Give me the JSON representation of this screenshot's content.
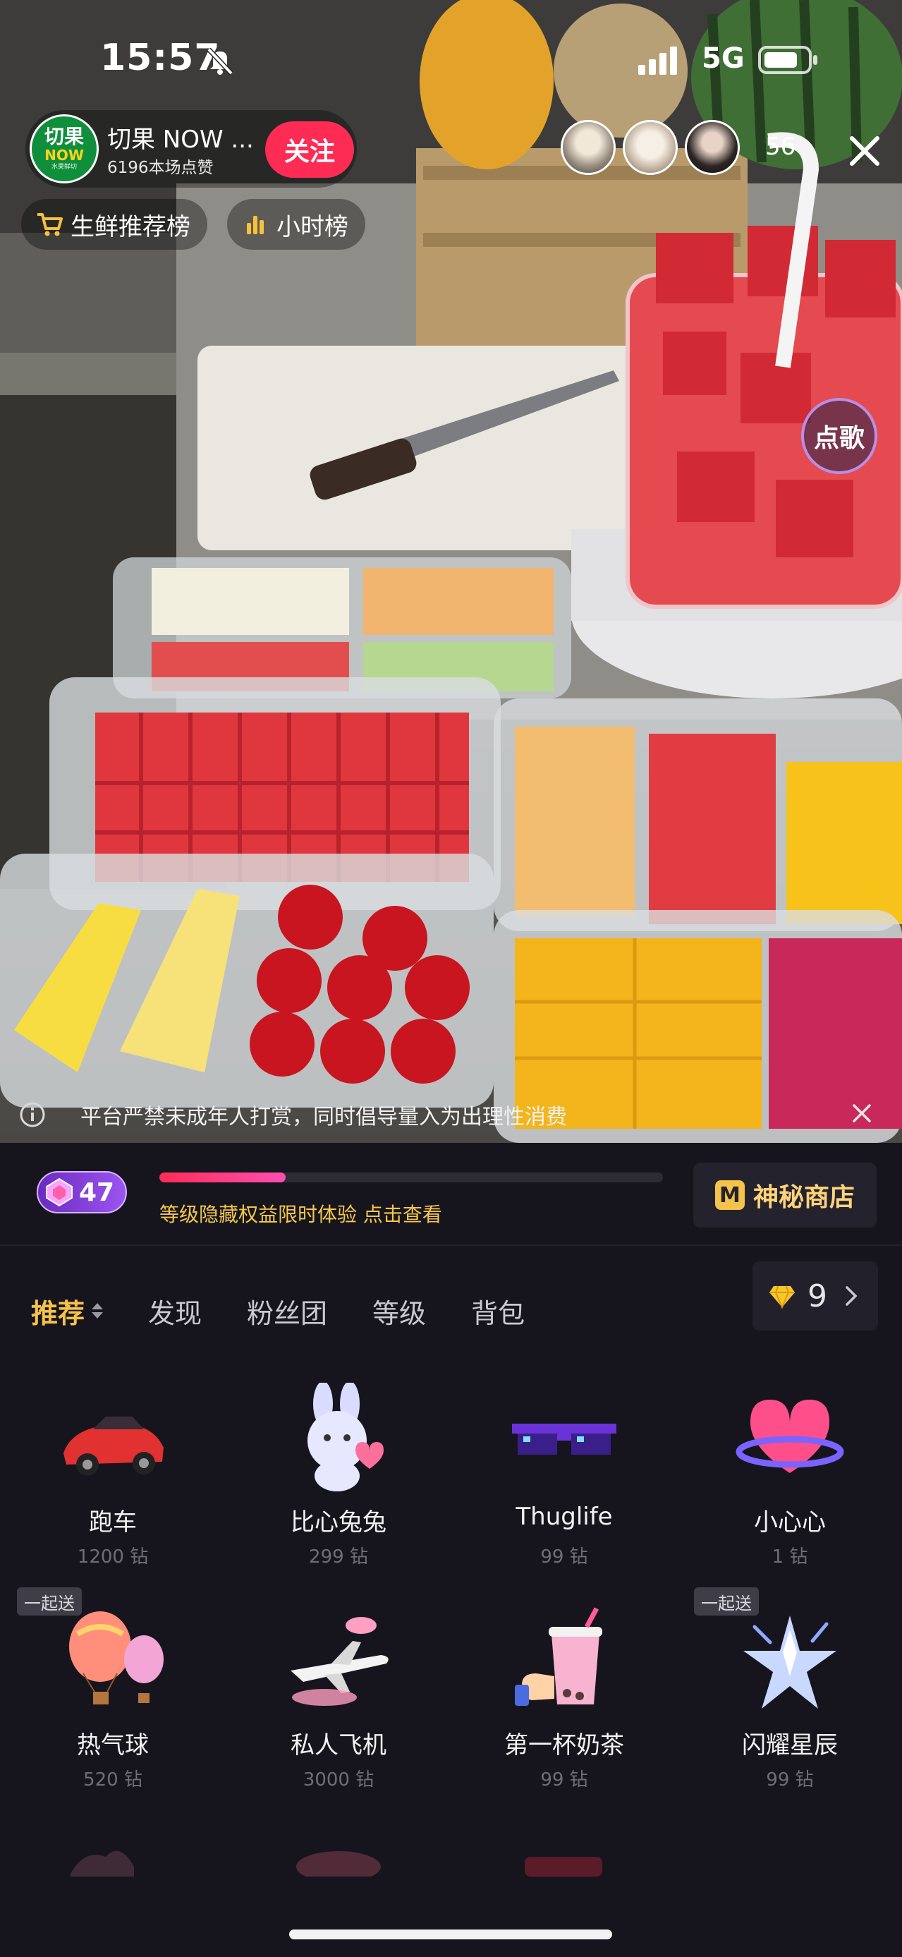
{
  "status_bar": {
    "time": "15:57",
    "network": "5G"
  },
  "streamer": {
    "avatar_line1": "切果",
    "avatar_line2": "NOW",
    "avatar_line3": "水果鲜切",
    "name": "切果 NOW ...",
    "likes": "6196本场点赞",
    "follow_label": "关注"
  },
  "viewers": {
    "count": "56"
  },
  "pills": {
    "fresh_rank": "生鲜推荐榜",
    "hour_rank": "小时榜"
  },
  "song_button": "点歌",
  "notice": "平台严禁未成年人打赏，同时倡导量入为出理性消费",
  "level": {
    "badge_number": "47",
    "progress_fraction": 0.25,
    "hint": "等级隐藏权益限时体验 点击查看"
  },
  "shop_label": "神秘商店",
  "shop_logo": "M",
  "tabs": [
    {
      "label": "推荐"
    },
    {
      "label": "发现"
    },
    {
      "label": "粉丝团"
    },
    {
      "label": "等级"
    },
    {
      "label": "背包"
    }
  ],
  "balance": "9",
  "gifts": [
    {
      "name": "跑车",
      "price": "1200 钻",
      "tag": "",
      "icon": "sports-car-icon"
    },
    {
      "name": "比心兔兔",
      "price": "299 钻",
      "tag": "",
      "icon": "heart-bunny-icon"
    },
    {
      "name": "Thuglife",
      "price": "99 钻",
      "tag": "",
      "icon": "pixel-sunglasses-icon"
    },
    {
      "name": "小心心",
      "price": "1 钻",
      "tag": "",
      "icon": "heart-ring-icon"
    },
    {
      "name": "热气球",
      "price": "520 钻",
      "tag": "一起送",
      "icon": "hot-air-balloon-icon"
    },
    {
      "name": "私人飞机",
      "price": "3000 钻",
      "tag": "",
      "icon": "private-jet-icon"
    },
    {
      "name": "第一杯奶茶",
      "price": "99 钻",
      "tag": "",
      "icon": "milk-tea-icon"
    },
    {
      "name": "闪耀星辰",
      "price": "99 钻",
      "tag": "一起送",
      "icon": "shining-star-icon"
    }
  ],
  "colors": {
    "accent_pink": "#fe2c55",
    "gold": "#f5c24b",
    "panel_bg": "#16151e"
  }
}
